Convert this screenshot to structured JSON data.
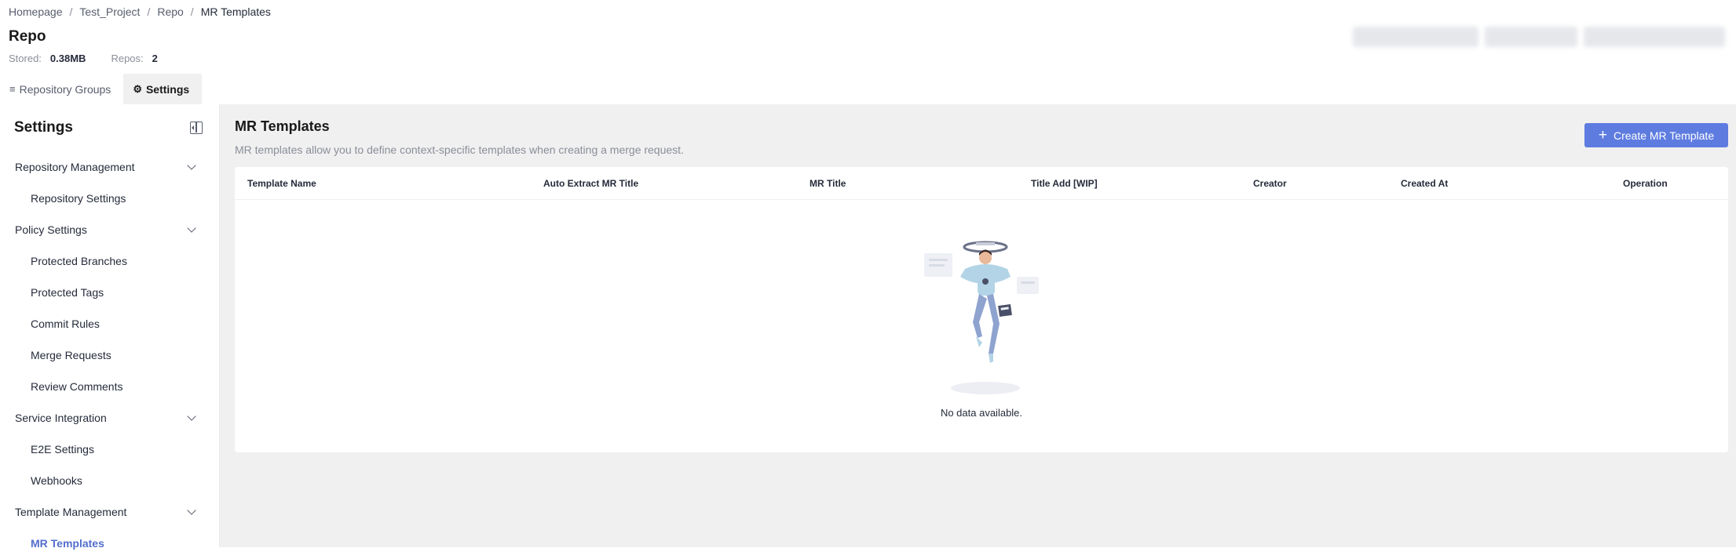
{
  "breadcrumb": [
    "Homepage",
    "Test_Project",
    "Repo",
    "MR Templates"
  ],
  "repo": {
    "title": "Repo",
    "stored_label": "Stored:",
    "stored_value": "0.38MB",
    "repos_label": "Repos:",
    "repos_value": "2"
  },
  "tabs": [
    {
      "label": "Repository Groups",
      "icon": "list-icon",
      "active": false
    },
    {
      "label": "Settings",
      "icon": "gear-icon",
      "active": true
    }
  ],
  "sidebar": {
    "title": "Settings",
    "groups": [
      {
        "label": "Repository Management",
        "items": [
          "Repository Settings"
        ]
      },
      {
        "label": "Policy Settings",
        "items": [
          "Protected Branches",
          "Protected Tags",
          "Commit Rules",
          "Merge Requests",
          "Review Comments"
        ]
      },
      {
        "label": "Service Integration",
        "items": [
          "E2E Settings",
          "Webhooks"
        ]
      },
      {
        "label": "Template Management",
        "items": [
          "MR Templates"
        ]
      }
    ],
    "active_item": "MR Templates"
  },
  "main": {
    "title": "MR Templates",
    "description": "MR templates allow you to define context-specific templates when creating a merge request.",
    "create_button": "Create MR Template",
    "columns": [
      "Template Name",
      "Auto Extract MR Title",
      "MR Title",
      "Title Add [WIP]",
      "Creator",
      "Created At",
      "Operation"
    ],
    "rows": [],
    "empty_text": "No data available."
  },
  "colors": {
    "accent": "#5e7ce0",
    "active_menu": "#526ecc",
    "page_bg": "#f0f0f0"
  }
}
